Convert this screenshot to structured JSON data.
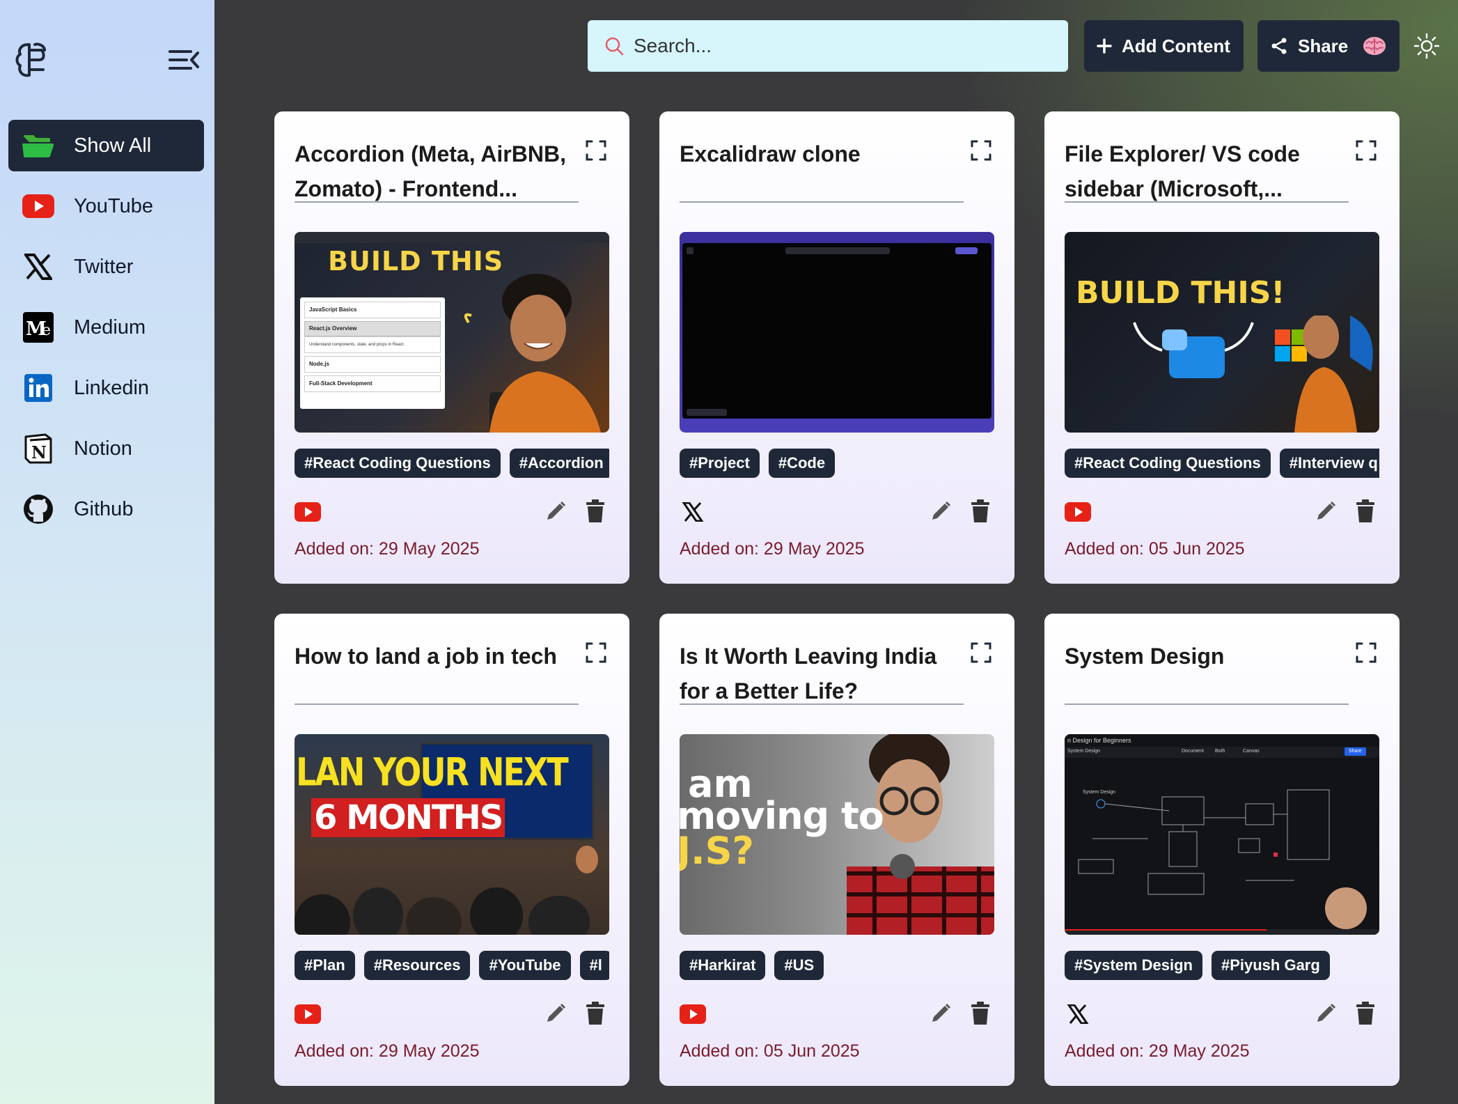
{
  "header": {
    "search_placeholder": "Search...",
    "add_label": "Add Content",
    "share_label": "Share"
  },
  "sidebar": {
    "items": [
      {
        "label": "Show All",
        "icon": "folder-open-icon",
        "active": true
      },
      {
        "label": "YouTube",
        "icon": "youtube-icon"
      },
      {
        "label": "Twitter",
        "icon": "x-icon"
      },
      {
        "label": "Medium",
        "icon": "medium-icon"
      },
      {
        "label": "Linkedin",
        "icon": "linkedin-icon"
      },
      {
        "label": "Notion",
        "icon": "notion-icon"
      },
      {
        "label": "Github",
        "icon": "github-icon"
      }
    ]
  },
  "cards": [
    {
      "title": "Accordion (Meta, AirBNB, Zomato) - Frontend...",
      "tags": [
        "#React Coding Questions",
        "#Accordion"
      ],
      "source": "youtube",
      "added": "Added on: 29 May 2025",
      "thumb_text": "BUILD THIS",
      "thumb_items": [
        "JavaScript Basics",
        "React.js Overview",
        "Understand components, state, and props in React.",
        "Node.js",
        "Full-Stack Development"
      ]
    },
    {
      "title": "Excalidraw clone",
      "tags": [
        "#Project",
        "#Code"
      ],
      "source": "twitter",
      "added": "Added on: 29 May 2025"
    },
    {
      "title": "File Explorer/ VS code sidebar (Microsoft,...",
      "tags": [
        "#React Coding Questions",
        "#Interview q"
      ],
      "source": "youtube",
      "added": "Added on: 05 Jun 2025",
      "thumb_text": "BUILD THIS!"
    },
    {
      "title": "How to land a job in tech",
      "tags": [
        "#Plan",
        "#Resources",
        "#YouTube",
        "#l"
      ],
      "source": "youtube",
      "added": "Added on: 29 May 2025",
      "thumb_text": "LAN YOUR NEXT",
      "thumb_text2": "6 MONTHS"
    },
    {
      "title": "Is It Worth Leaving India for a Better Life?",
      "tags": [
        "#Harkirat",
        "#US"
      ],
      "source": "youtube",
      "added": "Added on: 05 Jun 2025",
      "thumb_text": "am",
      "thumb_text2": "moving to",
      "thumb_text3": "J.S?"
    },
    {
      "title": "System Design",
      "tags": [
        "#System Design",
        "#Piyush Garg"
      ],
      "source": "twitter",
      "added": "Added on: 29 May 2025",
      "thumb_text": "n Design for Beginners",
      "thumb_text2": "System Design",
      "thumb_text3": "System Design",
      "thumb_tabs": [
        "Document",
        "Both",
        "Canvas"
      ],
      "thumb_share": "Share"
    }
  ],
  "colors": {
    "accent": "#1f2838",
    "date": "#7a1b2b",
    "search_bg": "#d6f6fb",
    "youtube": "#e62117"
  }
}
